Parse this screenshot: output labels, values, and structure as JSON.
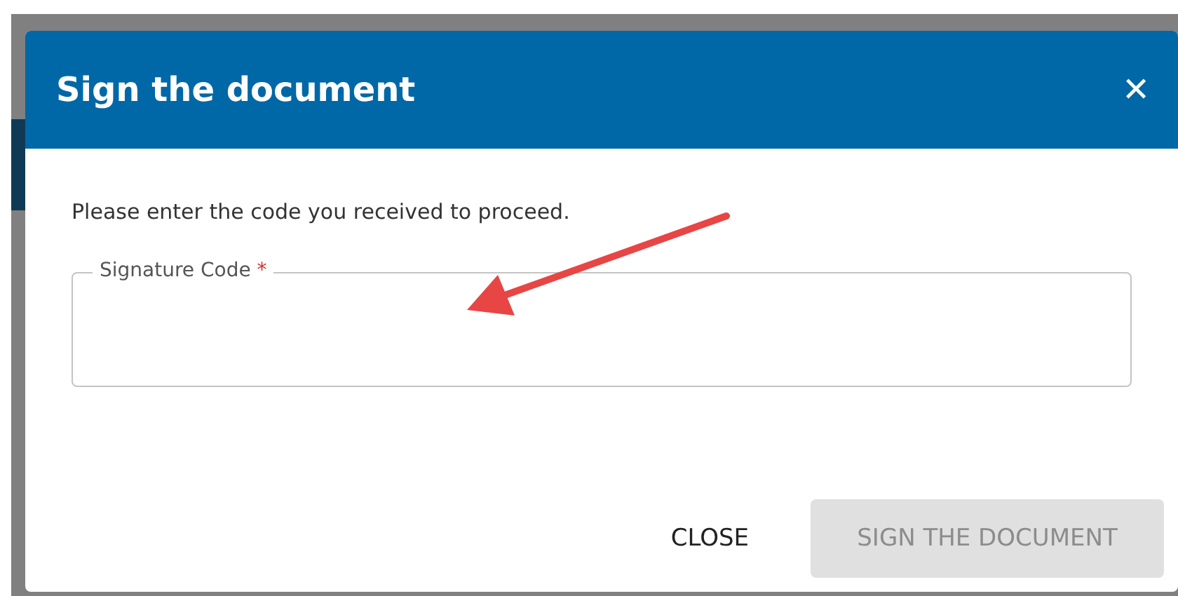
{
  "dialog": {
    "title": "Sign the document",
    "close_icon": "✕",
    "message": "Please enter the code you received to proceed.",
    "field": {
      "label": "Signature Code",
      "required": true,
      "required_mark": "*"
    },
    "buttons": [
      {
        "label": "CLOSE",
        "kind": "text",
        "disabled": false
      },
      {
        "label": "SIGN THE DOCUMENT",
        "kind": "contained",
        "disabled": true
      }
    ]
  }
}
